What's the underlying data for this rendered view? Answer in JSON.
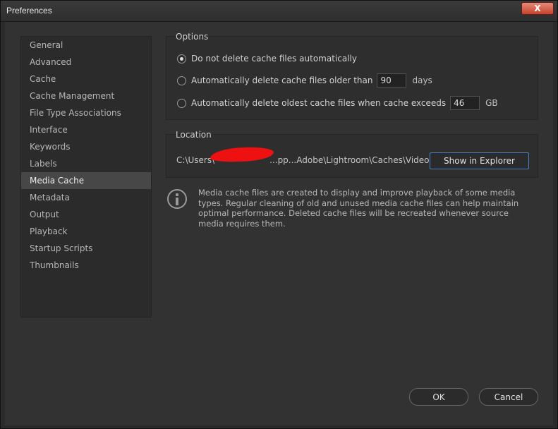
{
  "window": {
    "title": "Preferences",
    "close_glyph": "X"
  },
  "sidebar": {
    "items": [
      {
        "label": "General"
      },
      {
        "label": "Advanced"
      },
      {
        "label": "Cache"
      },
      {
        "label": "Cache Management"
      },
      {
        "label": "File Type Associations"
      },
      {
        "label": "Interface"
      },
      {
        "label": "Keywords"
      },
      {
        "label": "Labels"
      },
      {
        "label": "Media Cache",
        "selected": true
      },
      {
        "label": "Metadata"
      },
      {
        "label": "Output"
      },
      {
        "label": "Playback"
      },
      {
        "label": "Startup Scripts"
      },
      {
        "label": "Thumbnails"
      }
    ]
  },
  "options": {
    "title": "Options",
    "radio_1": "Do not delete cache files automatically",
    "radio_2": "Automatically delete cache files older than",
    "radio_2_value": "90",
    "radio_2_unit": "days",
    "radio_3": "Automatically delete oldest cache files when cache exceeds",
    "radio_3_value": "46",
    "radio_3_unit": "GB",
    "selected_option": 1
  },
  "location": {
    "title": "Location",
    "path_prefix": "C:\\Users\\",
    "path_suffix": "...pp...Adobe\\Lightroom\\Caches\\Video",
    "show_button": "Show in Explorer"
  },
  "info": {
    "icon": "info-icon",
    "text": "Media cache files are created to display and improve playback of some media types. Regular cleaning of old and unused media cache files can help maintain optimal performance. Deleted cache files will be recreated whenever source media requires them."
  },
  "footer": {
    "ok": "OK",
    "cancel": "Cancel"
  },
  "colors": {
    "accent_border": "#4a7fc1",
    "selected_bg": "#474747",
    "redaction": "#ee1111"
  }
}
